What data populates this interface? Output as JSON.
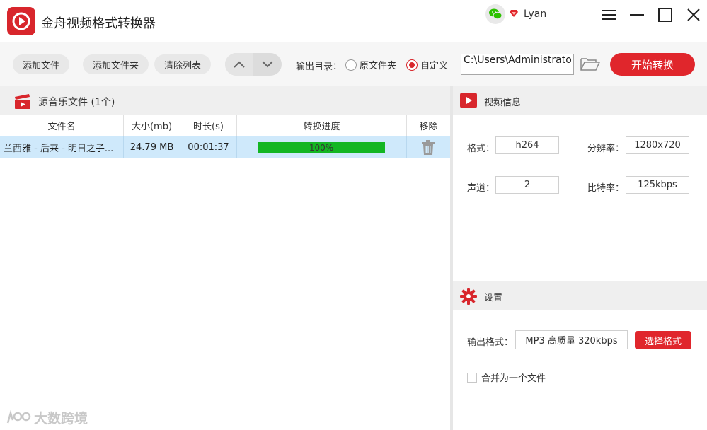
{
  "app": {
    "title": "金舟视频格式转换器"
  },
  "user": {
    "name": "Lyan"
  },
  "toolbar": {
    "add_file": "添加文件",
    "add_folder": "添加文件夹",
    "clear_list": "清除列表",
    "output_dir_label": "输出目录：",
    "radio_original": "原文件夹",
    "radio_custom": "自定义",
    "selected_radio": "自定义",
    "path_value": "C:\\Users\\Administrator\\",
    "start_label": "开始转换"
  },
  "file_list": {
    "title": "源音乐文件 (1个)",
    "columns": [
      "文件名",
      "大小(mb)",
      "时长(s)",
      "转换进度",
      "移除"
    ],
    "rows": [
      {
        "name": "兰西雅 - 后来 - 明日之子...",
        "size": "24.79 MB",
        "duration": "00:01:37",
        "progress_text": "100%",
        "progress": 1.0
      }
    ]
  },
  "video_info": {
    "title": "视频信息",
    "format_label": "格式：",
    "format_value": "h264",
    "resolution_label": "分辨率：",
    "resolution_value": "1280x720",
    "channel_label": "声道：",
    "channel_value": "2",
    "bitrate_label": "比特率：",
    "bitrate_value": "125kbps"
  },
  "settings": {
    "title": "设置",
    "output_format_label": "输出格式：",
    "output_format_value": "MP3 高质量 320kbps",
    "choose_format": "选择格式",
    "merge_label": "合并为一个文件",
    "merge_checked": false
  },
  "watermark": {
    "text": "大数跨境"
  },
  "colors": {
    "accent": "#e0262c",
    "progress": "#13b623",
    "row_selected": "#cfe9fb"
  },
  "icons": [
    "app-logo-icon",
    "wechat-icon",
    "vip-diamond-icon",
    "menu-icon",
    "minimize-icon",
    "maximize-icon",
    "close-icon",
    "arrow-up-icon",
    "arrow-down-icon",
    "folder-open-icon",
    "film-clapper-icon",
    "video-play-icon",
    "settings-gear-icon",
    "trash-icon"
  ]
}
